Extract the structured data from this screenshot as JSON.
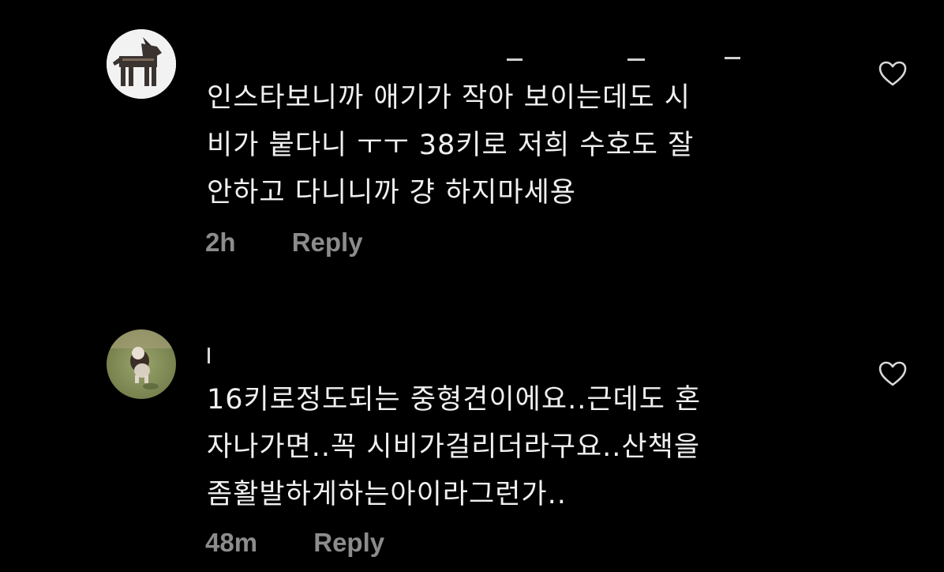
{
  "theme": {
    "background": "#000000",
    "text": "#f0f0f0",
    "meta": "#8c8c8c"
  },
  "comments": [
    {
      "avatar_icon": "dog-silhouette-avatar",
      "lines": [
        "인스타보니까 애기가 작아 보이는데도 시",
        "비가 붙다니 ㅜㅜ  38키로 저희 수호도 잘",
        "안하고 다니니까 걍 하지마세용"
      ],
      "time": "2h",
      "reply_label": "Reply",
      "like_icon": "heart-outline-icon"
    },
    {
      "avatar_icon": "dog-photo-avatar",
      "lines": [
        "16키로정도되는 중형견이에요..근데도 혼",
        "자나가면..꼭 시비가걸리더라구요..산책을",
        "좀활발하게하는아이라그런가.."
      ],
      "time": "48m",
      "reply_label": "Reply",
      "like_icon": "heart-outline-icon"
    }
  ]
}
